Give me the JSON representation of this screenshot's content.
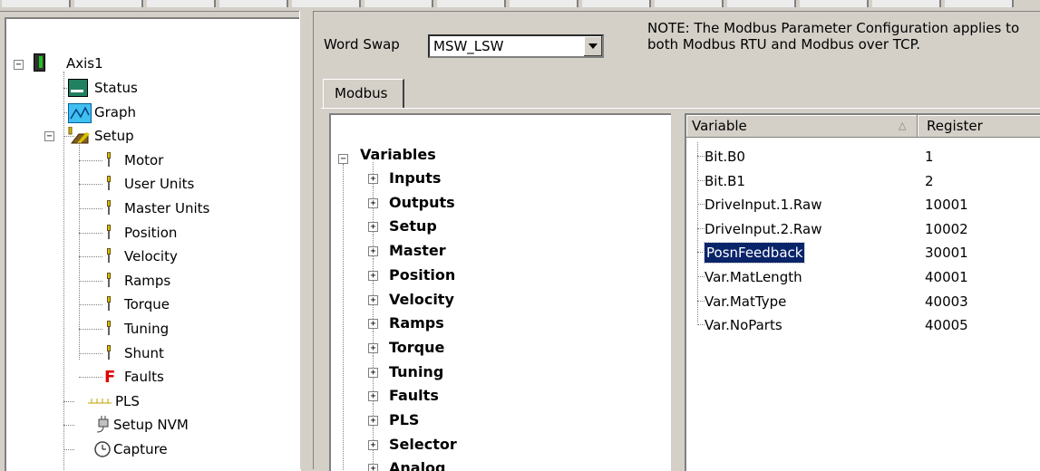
{
  "top_toolbar": {
    "segments": 14
  },
  "tree": {
    "root": {
      "label": "Axis1",
      "icon": "drive-icon"
    },
    "items": [
      {
        "label": "Status",
        "icon": "status-monitor-icon"
      },
      {
        "label": "Graph",
        "icon": "graph-icon"
      },
      {
        "label": "Setup",
        "icon": "setup-folder-icon"
      },
      {
        "label": "Motor",
        "icon": "pin-icon"
      },
      {
        "label": "User Units",
        "icon": "pin-icon"
      },
      {
        "label": "Master Units",
        "icon": "pin-icon"
      },
      {
        "label": "Position",
        "icon": "pin-icon"
      },
      {
        "label": "Velocity",
        "icon": "pin-icon"
      },
      {
        "label": "Ramps",
        "icon": "pin-icon"
      },
      {
        "label": "Torque",
        "icon": "pin-icon"
      },
      {
        "label": "Tuning",
        "icon": "pin-icon"
      },
      {
        "label": "Shunt",
        "icon": "pin-icon"
      },
      {
        "label": "Faults",
        "icon": "faults-f-icon"
      },
      {
        "label": "PLS",
        "icon": "pls-ruler-icon"
      },
      {
        "label": "Setup NVM",
        "icon": "nvm-plug-icon"
      },
      {
        "label": "Capture",
        "icon": "clock-icon"
      }
    ]
  },
  "word_swap": {
    "label": "Word Swap",
    "value": "MSW_LSW"
  },
  "note": {
    "line1": "NOTE: The Modbus Parameter Configuration applies to",
    "line2": "both Modbus RTU and Modbus over TCP."
  },
  "tabs": [
    {
      "label": "Modbus"
    }
  ],
  "variables_tree": {
    "root": "Variables",
    "groups": [
      "Inputs",
      "Outputs",
      "Setup",
      "Master",
      "Position",
      "Velocity",
      "Ramps",
      "Torque",
      "Tuning",
      "Faults",
      "PLS",
      "Selector",
      "Analog"
    ]
  },
  "register_list": {
    "columns": [
      "Variable",
      "Register"
    ],
    "rows": [
      {
        "variable": "Bit.B0",
        "register": "1"
      },
      {
        "variable": "Bit.B1",
        "register": "2"
      },
      {
        "variable": "DriveInput.1.Raw",
        "register": "10001"
      },
      {
        "variable": "DriveInput.2.Raw",
        "register": "10002"
      },
      {
        "variable": "PosnFeedback",
        "register": "30001",
        "selected": true
      },
      {
        "variable": "Var.MatLength",
        "register": "40001"
      },
      {
        "variable": "Var.MatType",
        "register": "40003"
      },
      {
        "variable": "Var.NoParts",
        "register": "40005"
      }
    ]
  },
  "colors": {
    "selection": "#0a246a",
    "window": "#d4d0c8",
    "faults_icon": "#e00000"
  }
}
